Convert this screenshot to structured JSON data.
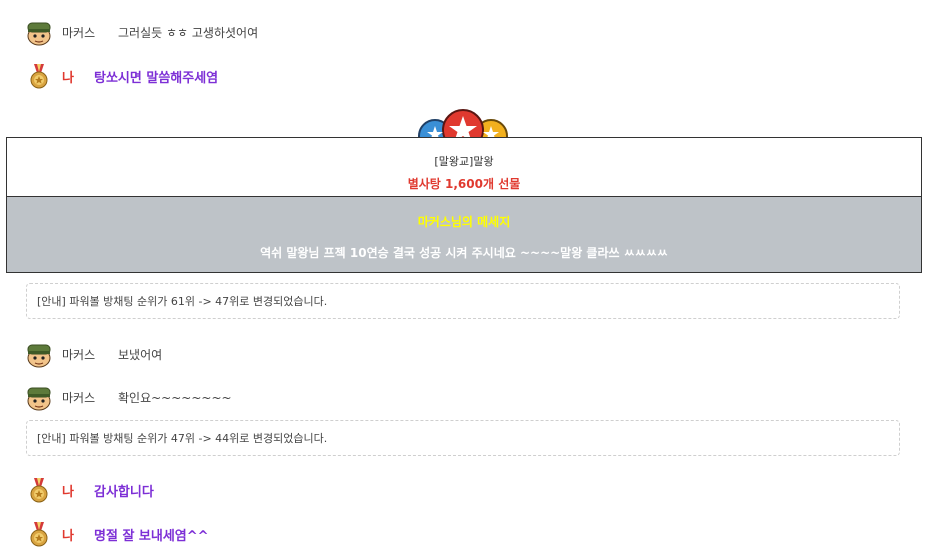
{
  "chat": [
    {
      "avatar": "soldier-avatar-icon",
      "name": "마커스",
      "message": "그러실듯 ㅎㅎ 고생하셧어여"
    },
    {
      "avatar": "medal-icon",
      "name": "나",
      "message": "탕쏘시면 말씀해주세염"
    }
  ],
  "gift": {
    "icon": "star-balloons-icon",
    "sender": "[말왕교]말왕",
    "item": "별사탕 1,600개 선물",
    "message_title": "마커스님의 메세지",
    "message_text": "역쉬 말왕님 프젝 10연승 결국 성공 시켜 주시네요 ~~~~말왕 클라쓰 ㅆㅆㅆㅆ"
  },
  "notices": [
    "[안내] 파워볼 방채팅 순위가 61위 -> 47위로 변경되었습니다.",
    "[안내] 파워볼 방채팅 순위가 47위 -> 44위로 변경되었습니다."
  ],
  "chat2": [
    {
      "avatar": "soldier-avatar-icon",
      "name": "마커스",
      "message": "보냈어여"
    },
    {
      "avatar": "soldier-avatar-icon",
      "name": "마커스",
      "message": "확인요~~~~~~~~"
    }
  ],
  "chat3": [
    {
      "avatar": "medal-icon",
      "name": "나",
      "message": "감사합니다"
    },
    {
      "avatar": "medal-icon",
      "name": "나",
      "message": "명절 잘 보내세염^^"
    }
  ],
  "colors": {
    "my_name": "#e0392f",
    "my_message": "#7d2fd6",
    "gift_item": "#e0392f",
    "gift_msg_bg": "#bec3c8",
    "gift_msg_title": "#ffff00"
  }
}
